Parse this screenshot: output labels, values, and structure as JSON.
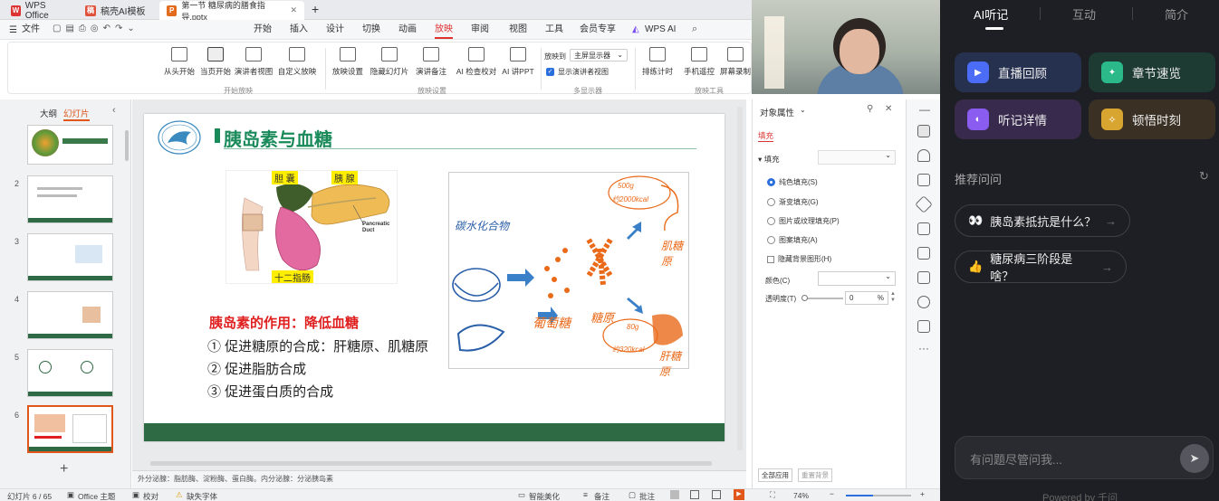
{
  "titlebar": {
    "tabs": [
      {
        "label": "WPS Office",
        "logo": "W",
        "color": "#d33"
      },
      {
        "label": "稿壳AI模板",
        "logo": "稿",
        "color": "#e0503a"
      },
      {
        "label": "第一节 糖尿病的膳食指导.pptx",
        "logo": "P",
        "color": "#e36b1d"
      }
    ],
    "new_tab": "+"
  },
  "menubar": {
    "file": "文件",
    "items": [
      "开始",
      "插入",
      "设计",
      "切换",
      "动画",
      "放映",
      "审阅",
      "视图",
      "工具",
      "会员专享"
    ],
    "active": "放映",
    "wps_ai": "WPS AI"
  },
  "ribbon": {
    "buttons": [
      "从头开始",
      "当页开始",
      "演讲者视图",
      "自定义放映",
      "放映设置",
      "隐藏幻灯片",
      "演讲备注",
      "AI 检查校对",
      "AI 讲PPT",
      "排练计时",
      "手机遥控",
      "屏幕录制"
    ],
    "monitor_label": "放映到",
    "monitor_value": "主屏显示器",
    "presenter_check": "显示演讲者视图",
    "groups": [
      "开始放映",
      "放映设置",
      "多显示器",
      "放映工具"
    ]
  },
  "leftpane": {
    "tabs": [
      "大纲",
      "幻灯片"
    ],
    "active_tab": "幻灯片",
    "slides": [
      "1",
      "2",
      "3",
      "4",
      "5",
      "6"
    ],
    "active_slide": "6",
    "add": "+"
  },
  "slide": {
    "title": "胰岛素与血糖",
    "labels": {
      "gallbladder": "胆 囊",
      "pancreas": "胰 腺",
      "duodenum": "十二指肠",
      "duct": "Pancreatic\nDuct"
    },
    "function_title": "胰岛素的作用：降低血糖",
    "points": [
      "① 促进糖原的合成：肝糖原、肌糖原",
      "② 促进脂肪合成",
      "③ 促进蛋白质的合成"
    ],
    "sketch": {
      "carb": "碳水化合物",
      "glucose": "葡萄糖",
      "glycogen": "糖原",
      "muscle_amount": "500g",
      "muscle_kcal": "约2000kcal",
      "liver_amount": "80g",
      "liver_kcal": "约320kcal",
      "muscle": "肌糖原",
      "liver": "肝糖原"
    }
  },
  "notes": "外分泌腺：脂肪酶、淀粉酶、蛋白酶。内分泌腺：分泌胰岛素",
  "props": {
    "title": "对象属性",
    "fill_tab": "填充",
    "fill_section": "填充",
    "options": [
      "纯色填充(S)",
      "渐变填充(G)",
      "图片或纹理填充(P)",
      "图案填充(A)",
      "隐藏背景图形(H)"
    ],
    "selected": "纯色填充(S)",
    "color_label": "颜色(C)",
    "transparency_label": "透明度(T)",
    "transparency_value": "0",
    "transparency_unit": "%",
    "apply_all": "全部应用",
    "reset": "重置背景"
  },
  "status": {
    "slide_counter": "幻灯片 6 / 65",
    "theme": "Office 主题",
    "proofread": "校对",
    "missing_font": "缺失字体",
    "beautify": "智能美化",
    "notes": "备注",
    "comments": "批注",
    "zoom": "74%"
  },
  "rpanel": {
    "tabs": [
      "AI听记",
      "互动",
      "简介"
    ],
    "active": "AI听记",
    "cards": [
      {
        "label": "直播回顾",
        "icon": "replay-icon",
        "bg": "#263150",
        "ic": "#4a6cf7"
      },
      {
        "label": "章节速览",
        "icon": "chapter-icon",
        "bg": "#1d3a33",
        "ic": "#2bb98a"
      },
      {
        "label": "听记详情",
        "icon": "microphone-icon",
        "bg": "#372a4d",
        "ic": "#8a5cf0"
      },
      {
        "label": "顿悟时刻",
        "icon": "lightbulb-icon",
        "bg": "#3b3024",
        "ic": "#d9a531"
      }
    ],
    "recommend_title": "推荐问问",
    "questions": [
      {
        "emoji": "👀",
        "text": "胰岛素抵抗是什么？"
      },
      {
        "emoji": "👍",
        "text": "糖尿病三阶段是啥？"
      }
    ],
    "input_placeholder": "有问题尽管问我...",
    "powered": "Powered by 千问"
  },
  "colors": {
    "accent": "#d33",
    "slide_title": "#1a8a5a",
    "function_red": "#e02020",
    "footer_green": "#2e6b45"
  }
}
